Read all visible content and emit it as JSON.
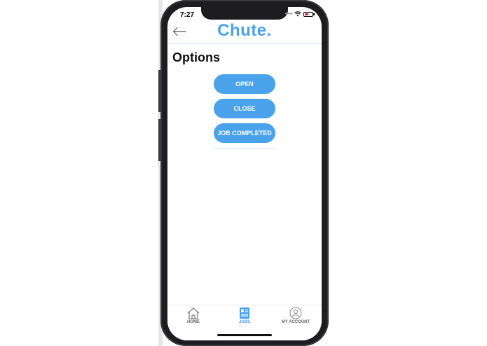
{
  "status_bar": {
    "time": "7:27"
  },
  "nav": {
    "logo": "Chute."
  },
  "page": {
    "title": "Options"
  },
  "options": [
    {
      "label": "OPEN"
    },
    {
      "label": "CLOSE"
    },
    {
      "label": "JOB COMPLETED"
    }
  ],
  "tabs": [
    {
      "label": "HOME"
    },
    {
      "label": "JOBS"
    },
    {
      "label": "MY ACCOUNT"
    }
  ],
  "colors": {
    "accent": "#4aa3ea",
    "text": "#111111",
    "tab_inactive": "#666666"
  },
  "icons": {
    "back": "arrow-left-icon",
    "home": "house-icon",
    "jobs": "clipboard-icon",
    "account": "user-circle-icon"
  }
}
